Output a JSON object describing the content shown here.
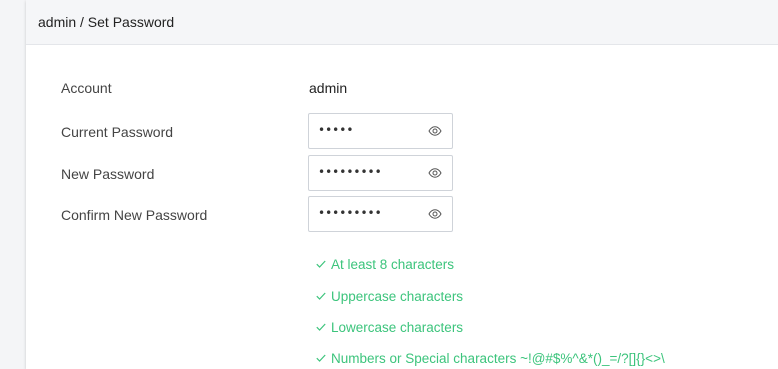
{
  "header": {
    "breadcrumb": "admin / Set Password"
  },
  "form": {
    "account_label": "Account",
    "account_value": "admin",
    "current_password_label": "Current Password",
    "current_password_masked": "•••••",
    "new_password_label": "New Password",
    "new_password_masked": "•••••••••",
    "confirm_password_label": "Confirm New Password",
    "confirm_password_masked": "•••••••••"
  },
  "rules": {
    "items": [
      "At least 8 characters",
      "Uppercase characters",
      "Lowercase characters",
      "Numbers or Special characters ~!@#$%^&*()_=/?[]{}<>\\"
    ],
    "status": "satisfied",
    "color": "#3cc47c"
  },
  "icons": {
    "toggle_visibility": "eye-icon",
    "rule_check": "check-icon"
  }
}
